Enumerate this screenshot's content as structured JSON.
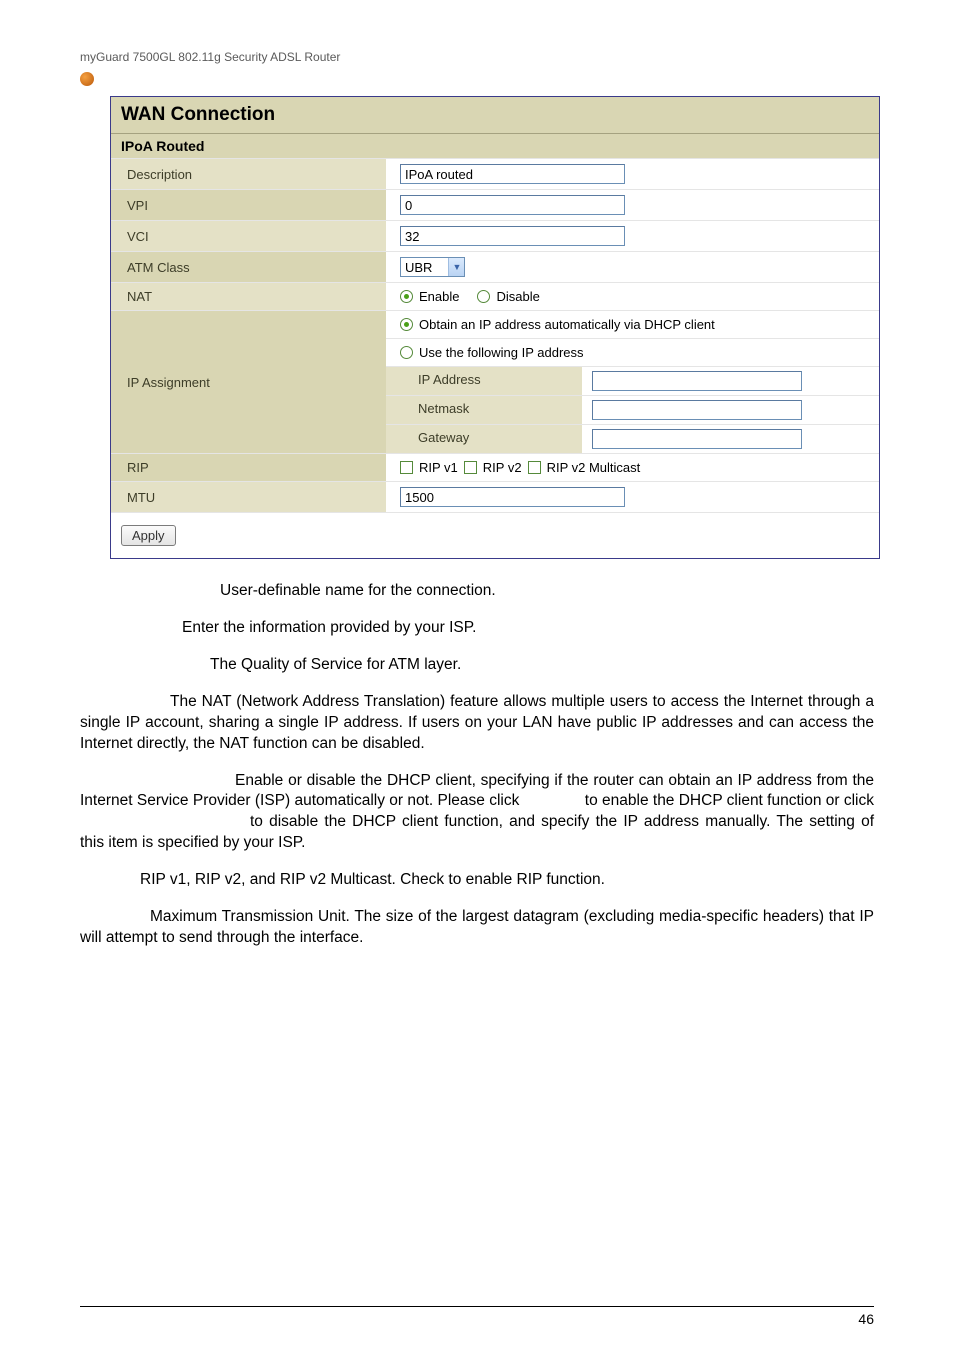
{
  "header": "myGuard 7500GL 802.11g Security ADSL Router",
  "panel_title": "WAN Connection",
  "panel_subtitle": "IPoA Routed",
  "rows": {
    "description": {
      "label": "Description",
      "value": "IPoA routed"
    },
    "vpi": {
      "label": "VPI",
      "value": "0"
    },
    "vci": {
      "label": "VCI",
      "value": "32"
    },
    "atm_class": {
      "label": "ATM Class",
      "value": "UBR"
    },
    "nat": {
      "label": "NAT",
      "enable": "Enable",
      "disable": "Disable"
    },
    "ip_assign": {
      "label": "IP Assignment",
      "auto": "Obtain an IP address automatically via DHCP client",
      "manual": "Use the following IP address",
      "ip_address": "IP Address",
      "netmask": "Netmask",
      "gateway": "Gateway"
    },
    "rip": {
      "label": "RIP",
      "v1": "RIP v1",
      "v2": "RIP v2",
      "v2m": "RIP v2 Multicast"
    },
    "mtu": {
      "label": "MTU",
      "value": "1500"
    }
  },
  "apply": "Apply",
  "body": {
    "p1": "User-definable name for the connection.",
    "p2": "Enter the information provided by your ISP.",
    "p3": "The Quality of Service for ATM layer.",
    "p4": "The NAT (Network Address Translation) feature allows multiple users to access the Internet through a single IP account, sharing a single IP address. If users on your LAN have public IP addresses and can access the Internet directly, the NAT function can be disabled.",
    "p5a": "Enable or disable the DHCP client, specifying if the router can obtain an IP address from the Internet Service Provider (ISP) automatically or not. Please click",
    "p5b": "to enable the DHCP client function or click",
    "p5c": "to disable the DHCP client function, and specify the IP address manually. The setting of this item is specified by your ISP.",
    "p6": "RIP v1, RIP v2, and RIP v2 Multicast. Check to enable RIP function.",
    "p7": "Maximum Transmission Unit. The size of the largest datagram (excluding media-specific headers) that IP will attempt to send through the interface."
  },
  "page_number": "46"
}
